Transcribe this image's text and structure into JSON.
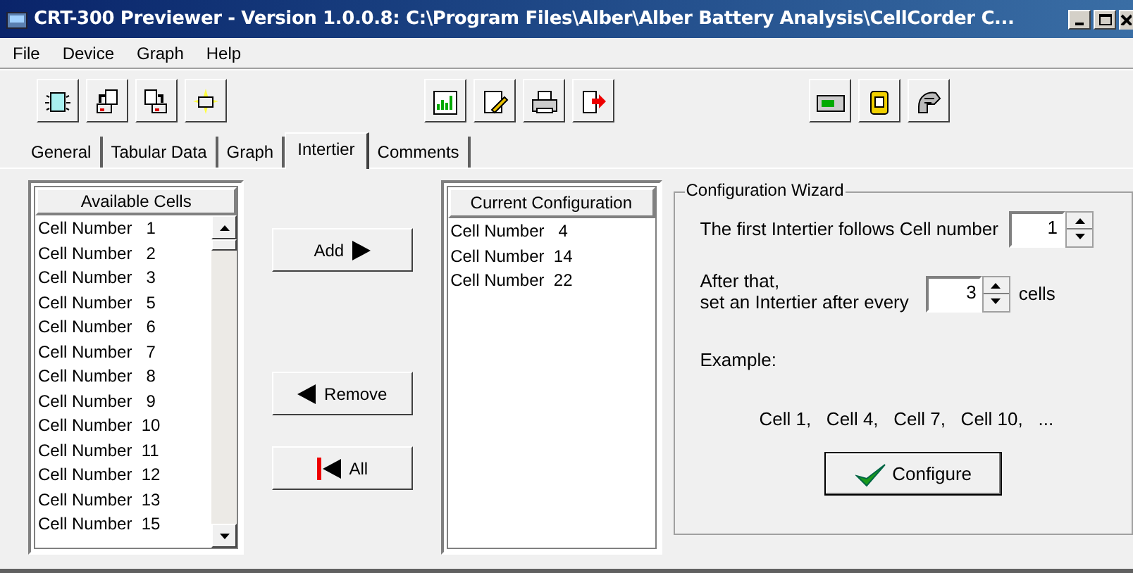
{
  "window": {
    "title": "CRT-300 Previewer - Version 1.0.0.8: C:\\Program Files\\Alber\\Alber Battery Analysis\\CellCorder C..."
  },
  "menu": [
    "File",
    "Device",
    "Graph",
    "Help"
  ],
  "toolbar": [
    [
      {
        "kind": "new"
      },
      {
        "kind": "open"
      },
      {
        "kind": "save"
      },
      {
        "kind": "clear"
      }
    ],
    [
      {
        "kind": "graph"
      },
      {
        "kind": "edit"
      },
      {
        "kind": "print"
      },
      {
        "kind": "export"
      }
    ],
    [
      {
        "kind": "device"
      },
      {
        "kind": "meter"
      },
      {
        "kind": "probe"
      }
    ]
  ],
  "tabs": [
    {
      "label": "General",
      "selected": false
    },
    {
      "label": "Tabular Data",
      "selected": false
    },
    {
      "label": "Graph",
      "selected": false
    },
    {
      "label": "Intertier",
      "selected": true
    },
    {
      "label": "Comments",
      "selected": false
    }
  ],
  "available_cells": {
    "header": "Available Cells",
    "items": [
      "Cell Number   1",
      "Cell Number   2",
      "Cell Number   3",
      "Cell Number   5",
      "Cell Number   6",
      "Cell Number   7",
      "Cell Number   8",
      "Cell Number   9",
      "Cell Number  10",
      "Cell Number  11",
      "Cell Number  12",
      "Cell Number  13",
      "Cell Number  15"
    ]
  },
  "actions": [
    {
      "kind": "add",
      "label": "Add"
    },
    {
      "kind": "remove",
      "label": "Remove"
    },
    {
      "kind": "all",
      "label": "All"
    }
  ],
  "current_configuration": {
    "header": "Current Configuration",
    "items": [
      "Cell Number   4",
      "Cell Number  14",
      "Cell Number  22"
    ]
  },
  "wizard": {
    "title": "Configuration Wizard",
    "first_label": "The first Intertier follows Cell number",
    "first_value": "1",
    "every_label_1": "After that,",
    "every_label_2": "set an Intertier after every",
    "every_value": "3",
    "every_suffix": "cells",
    "example_label": "Example:",
    "example": "Cell 1,   Cell 4,   Cell 7,   Cell 10,   ...",
    "button": "Configure"
  }
}
